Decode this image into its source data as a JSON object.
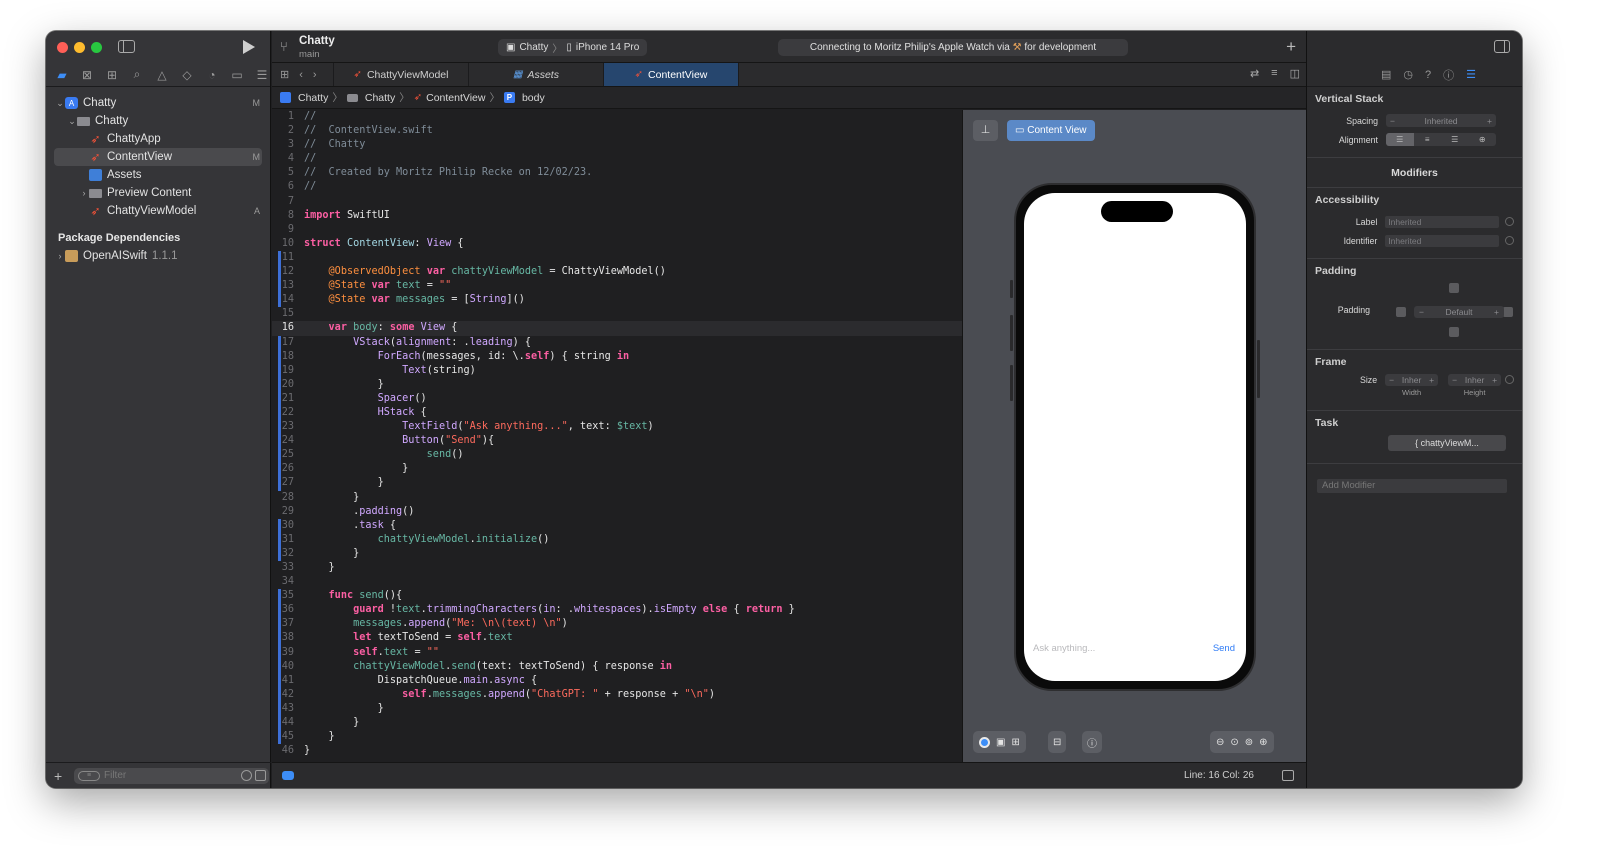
{
  "navigator": {
    "tree": [
      {
        "label": "Chatty",
        "badge": "M"
      },
      {
        "label": "Chatty",
        "badge": ""
      },
      {
        "label": "ChattyApp",
        "badge": ""
      },
      {
        "label": "ContentView",
        "badge": "M"
      },
      {
        "label": "Assets",
        "badge": ""
      },
      {
        "label": "Preview Content",
        "badge": ""
      },
      {
        "label": "ChattyViewModel",
        "badge": "A"
      }
    ],
    "package_header": "Package Dependencies",
    "package": {
      "name": "OpenAISwift",
      "version": "1.1.1"
    },
    "filter_placeholder": "Filter"
  },
  "toolbar": {
    "project": "Chatty",
    "branch": "main",
    "scheme": "Chatty",
    "scheme_sep": "〉",
    "device": "iPhone 14 Pro",
    "status_before": "Connecting to Moritz Philip's Apple Watch via",
    "status_after": "for development"
  },
  "tabs": [
    {
      "label": "ChattyViewModel"
    },
    {
      "label": "Assets"
    },
    {
      "label": "ContentView"
    }
  ],
  "jumpbar": [
    "Chatty",
    "Chatty",
    "ContentView",
    "body"
  ],
  "code": {
    "current_line": 16,
    "lines": [
      "1",
      "2",
      "3",
      "4",
      "5",
      "6",
      "7",
      "8",
      "9",
      "10",
      "11",
      "12",
      "13",
      "14",
      "15",
      "16",
      "17",
      "18",
      "19",
      "20",
      "21",
      "22",
      "23",
      "24",
      "25",
      "26",
      "27",
      "28",
      "29",
      "30",
      "31",
      "32",
      "33",
      "34",
      "35",
      "36",
      "37",
      "38",
      "39",
      "40",
      "41",
      "42",
      "43",
      "44",
      "45",
      "46"
    ]
  },
  "canvas": {
    "preview_label": "Content View",
    "ask_placeholder": "Ask anything...",
    "send_label": "Send"
  },
  "status_bar": {
    "position": "Line: 16  Col: 26"
  },
  "inspector": {
    "vstack_title": "Vertical Stack",
    "spacing_label": "Spacing",
    "spacing_value": "Inherited",
    "alignment_label": "Alignment",
    "modifiers_title": "Modifiers",
    "accessibility_title": "Accessibility",
    "label_label": "Label",
    "label_placeholder": "Inherited",
    "identifier_label": "Identifier",
    "identifier_placeholder": "Inherited",
    "padding_title": "Padding",
    "padding_label": "Padding",
    "padding_value": "Default",
    "frame_title": "Frame",
    "size_label": "Size",
    "width_value": "Inher",
    "height_value": "Inher",
    "width_caption": "Width",
    "height_caption": "Height",
    "task_title": "Task",
    "task_value": "{ chattyViewM...",
    "add_modifier": "Add Modifier"
  },
  "colors": {
    "accent": "#3d8ef7",
    "active_tab": "#26466e",
    "swift": "#f05138"
  }
}
